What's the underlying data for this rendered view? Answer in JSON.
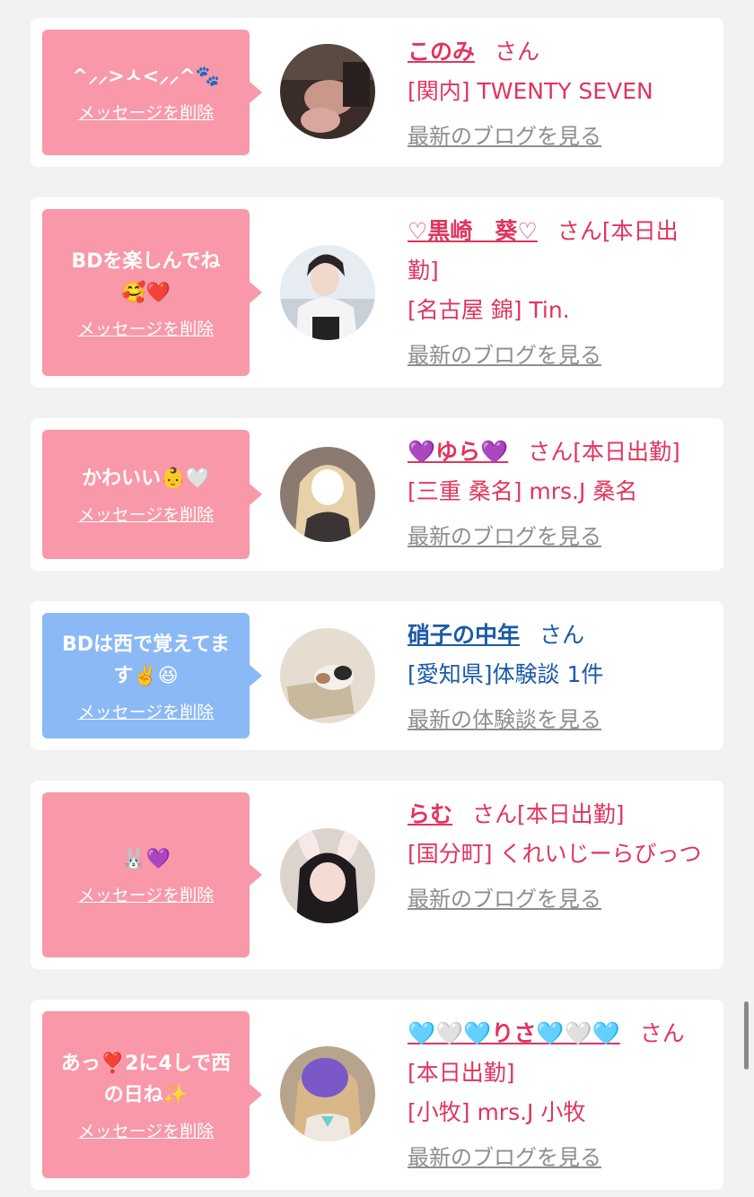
{
  "delete_label": "メッセージを削除",
  "colors": {
    "pink_bubble": "#f898a8",
    "blue_bubble": "#8bb9f5",
    "pink_text": "#e0355e",
    "blue_text": "#1c5aa6",
    "link_gray": "#8e8e8e"
  },
  "items": [
    {
      "message": "^⸝⸝>ㅅ<⸝⸝^🐾",
      "name": "このみ",
      "honorific": "さん",
      "status": "",
      "shop": "[関内] TWENTY SEVEN",
      "link": "最新のブログを見る"
    },
    {
      "message": "BDを楽しんでね🥰❤️",
      "name": "♡黒崎　葵♡",
      "honorific": "さん",
      "status": "[本日出勤]",
      "shop": "[名古屋 錦] Tin.",
      "link": "最新のブログを見る"
    },
    {
      "message": "かわいい👶🤍",
      "name": "💜ゆら💜",
      "honorific": "さん",
      "status": "[本日出勤]",
      "shop": "[三重 桑名] mrs.J 桑名",
      "link": "最新のブログを見る"
    },
    {
      "message": "BDは西で覚えてます✌️😆",
      "name": "硝子の中年",
      "honorific": "さん",
      "status": "",
      "shop": "[愛知県]体験談 1件",
      "link": "最新の体験談を見る"
    },
    {
      "message": "🐰💜",
      "name": "らむ",
      "honorific": "さん",
      "status": "[本日出勤]",
      "shop": "[国分町] くれいじーらびっつ",
      "link": "最新のブログを見る"
    },
    {
      "message": "あっ❣️2に4しで西の日ね✨",
      "name": "🩵🤍🩵りさ🩵🤍🩵",
      "honorific": "さん",
      "status": "[本日出勤]",
      "shop": "[小牧] mrs.J 小牧",
      "link": "最新のブログを見る"
    }
  ]
}
